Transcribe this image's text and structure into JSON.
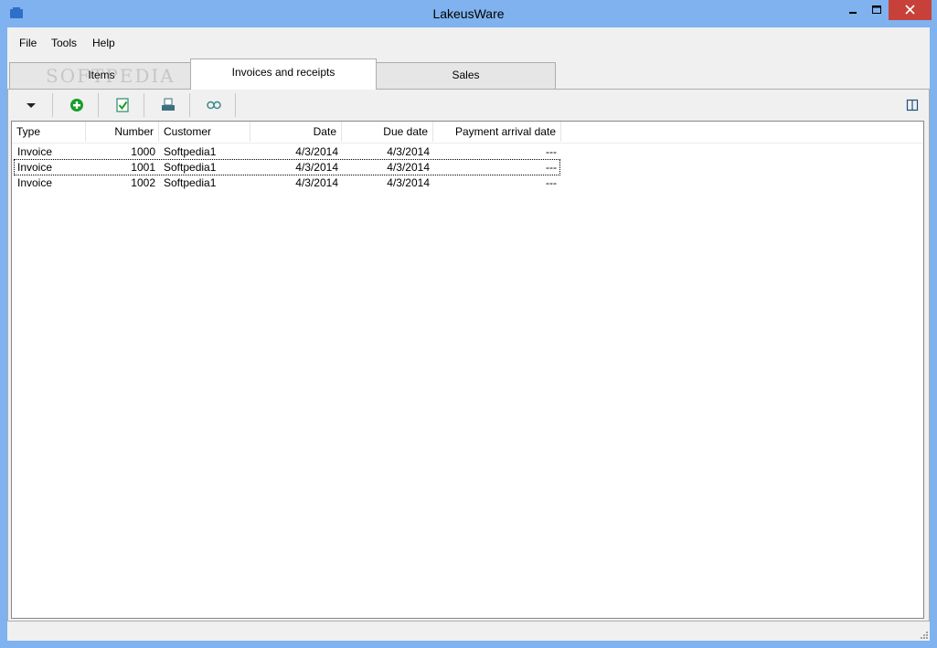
{
  "window": {
    "title": "LakeusWare"
  },
  "menu": {
    "items": [
      "File",
      "Tools",
      "Help"
    ]
  },
  "tabs": [
    {
      "label": "Items",
      "active": false
    },
    {
      "label": "Invoices and receipts",
      "active": true
    },
    {
      "label": "Sales",
      "active": false
    }
  ],
  "watermark": {
    "text": "SOFTPEDIA"
  },
  "toolbar": {
    "icons": [
      "dropdown-arrow-icon",
      "add-icon",
      "accept-document-icon",
      "print-icon",
      "view-icon",
      "split-panel-icon"
    ]
  },
  "table": {
    "columns": [
      "Type",
      "Number",
      "Customer",
      "Date",
      "Due date",
      "Payment arrival date"
    ],
    "rows": [
      {
        "type": "Invoice",
        "number": "1000",
        "customer": "Softpedia1",
        "date": "4/3/2014",
        "due": "4/3/2014",
        "payment": "---"
      },
      {
        "type": "Invoice",
        "number": "1001",
        "customer": "Softpedia1",
        "date": "4/3/2014",
        "due": "4/3/2014",
        "payment": "---"
      },
      {
        "type": "Invoice",
        "number": "1002",
        "customer": "Softpedia1",
        "date": "4/3/2014",
        "due": "4/3/2014",
        "payment": "---"
      }
    ]
  },
  "colors": {
    "titlebar": "#7fb2ee",
    "close": "#c7413a",
    "accent_green": "#1a9e2a"
  }
}
